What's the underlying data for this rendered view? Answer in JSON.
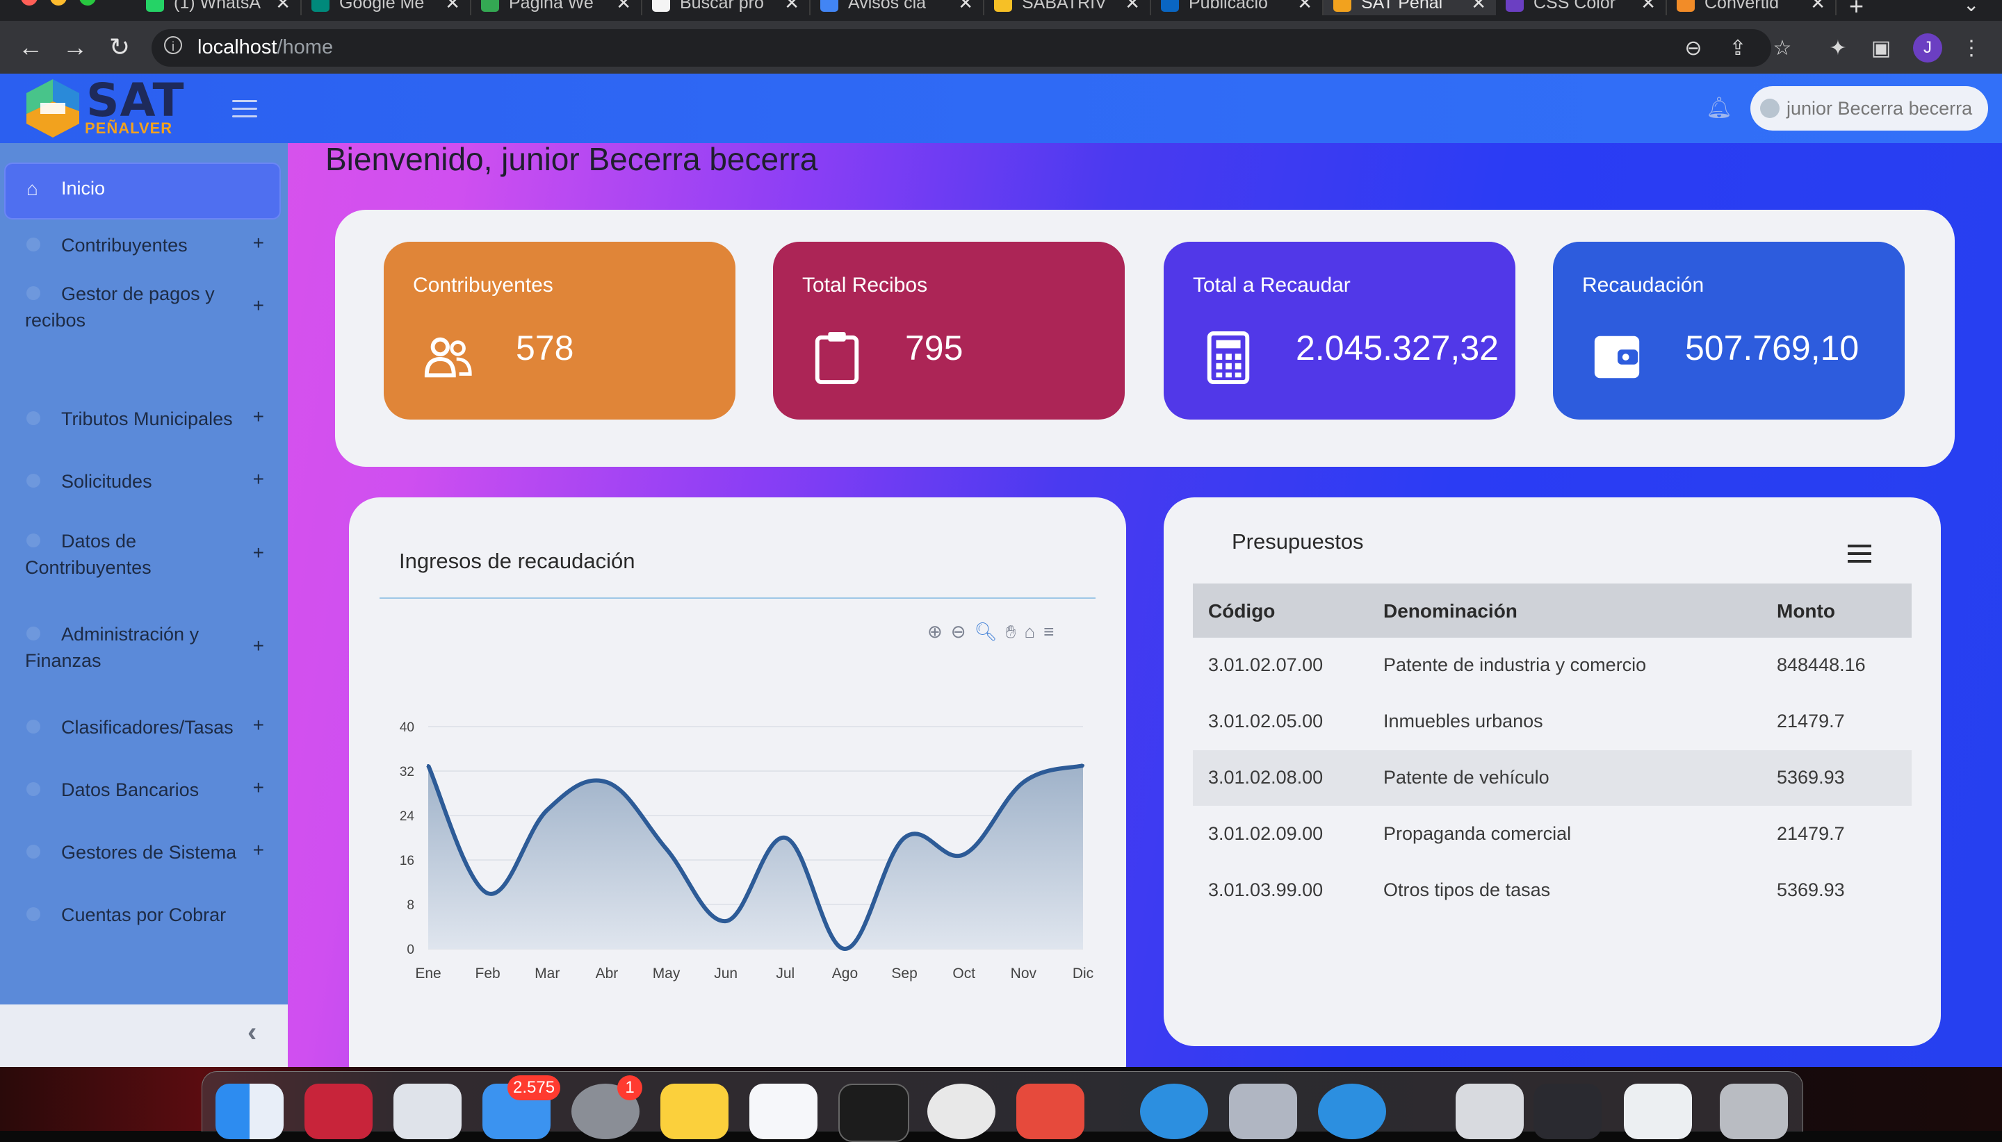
{
  "browser": {
    "tabs": [
      {
        "title": "(1) WhatsA",
        "favicon": "whatsapp-icon",
        "color": "#25d366"
      },
      {
        "title": "Google Me",
        "favicon": "google-meet-icon",
        "color": "#00897b"
      },
      {
        "title": "Página We",
        "favicon": "sheets-icon",
        "color": "#34a853"
      },
      {
        "title": "Buscar pro",
        "favicon": "docs-icon",
        "color": "#f4f4f4"
      },
      {
        "title": "Avisos cla",
        "favicon": "shield-icon",
        "color": "#4285f4"
      },
      {
        "title": "SABATRIV",
        "favicon": "bookmark-icon",
        "color": "#f6c026"
      },
      {
        "title": "Publicació",
        "favicon": "linkedin-icon",
        "color": "#0a66c2"
      },
      {
        "title": "SAT Peñal",
        "favicon": "sat-icon",
        "color": "#f2a21e",
        "active": true
      },
      {
        "title": "CSS Color",
        "favicon": "css-icon",
        "color": "#6b3fc2"
      },
      {
        "title": "Convertid",
        "favicon": "convert-icon",
        "color": "#f28c28"
      }
    ],
    "url_host": "localhost",
    "url_path": "/home",
    "profile_initial": "J"
  },
  "app": {
    "logo_text": "SAT",
    "logo_subtext": "PEÑALVER",
    "user_name": "junior Becerra becerra",
    "welcome": "Bienvenido, junior Becerra becerra"
  },
  "sidebar": {
    "active": "Inicio",
    "items": [
      {
        "label": "Contribuyentes"
      },
      {
        "label": "Gestor de pagos y recibos"
      },
      {
        "label": "Tributos Municipales"
      },
      {
        "label": "Solicitudes"
      },
      {
        "label": "Datos de Contribuyentes"
      },
      {
        "label": "Administración y Finanzas"
      },
      {
        "label": "Clasificadores/Tasas"
      },
      {
        "label": "Datos Bancarios"
      },
      {
        "label": "Gestores de Sistema"
      },
      {
        "label": "Cuentas por Cobrar"
      }
    ],
    "expand_symbol": "+"
  },
  "stats": [
    {
      "title": "Contribuyentes",
      "value": "578",
      "icon": "users-icon",
      "color": "#e08538"
    },
    {
      "title": "Total Recibos",
      "value": "795",
      "icon": "clipboard-icon",
      "color": "#ac2556"
    },
    {
      "title": "Total a Recaudar",
      "value": "2.045.327,32",
      "icon": "calculator-icon",
      "color": "#5138e8"
    },
    {
      "title": "Recaudación",
      "value": "507.769,10",
      "icon": "wallet-icon",
      "color": "#2d5cdd"
    }
  ],
  "chart_data": {
    "type": "area",
    "title": "Ingresos de recaudación",
    "categories": [
      "Ene",
      "Feb",
      "Mar",
      "Abr",
      "May",
      "Jun",
      "Jul",
      "Ago",
      "Sep",
      "Oct",
      "Nov",
      "Dic"
    ],
    "values": [
      33,
      10,
      25,
      30,
      18,
      5,
      20,
      0,
      20,
      17,
      30,
      33
    ],
    "ylim": [
      0,
      40
    ],
    "yticks": [
      0,
      8,
      16,
      24,
      32,
      40
    ],
    "line_color": "#2d5b97",
    "fill_top": "#9fb2c9",
    "fill_bottom": "#dfe5ee",
    "grid": true
  },
  "budget": {
    "title": "Presupuestos",
    "columns": [
      "Código",
      "Denominación",
      "Monto"
    ],
    "rows": [
      [
        "3.01.02.07.00",
        "Patente de industria y comercio",
        "848448.16"
      ],
      [
        "3.01.02.05.00",
        "Inmuebles urbanos",
        "21479.7"
      ],
      [
        "3.01.02.08.00",
        "Patente de vehículo",
        "5369.93"
      ],
      [
        "3.01.02.09.00",
        "Propaganda comercial",
        "21479.7"
      ],
      [
        "3.01.03.99.00",
        "Otros tipos de tasas",
        "5369.93"
      ]
    ]
  },
  "dock": {
    "mail_badge": "2.575",
    "settings_badge": "1"
  }
}
